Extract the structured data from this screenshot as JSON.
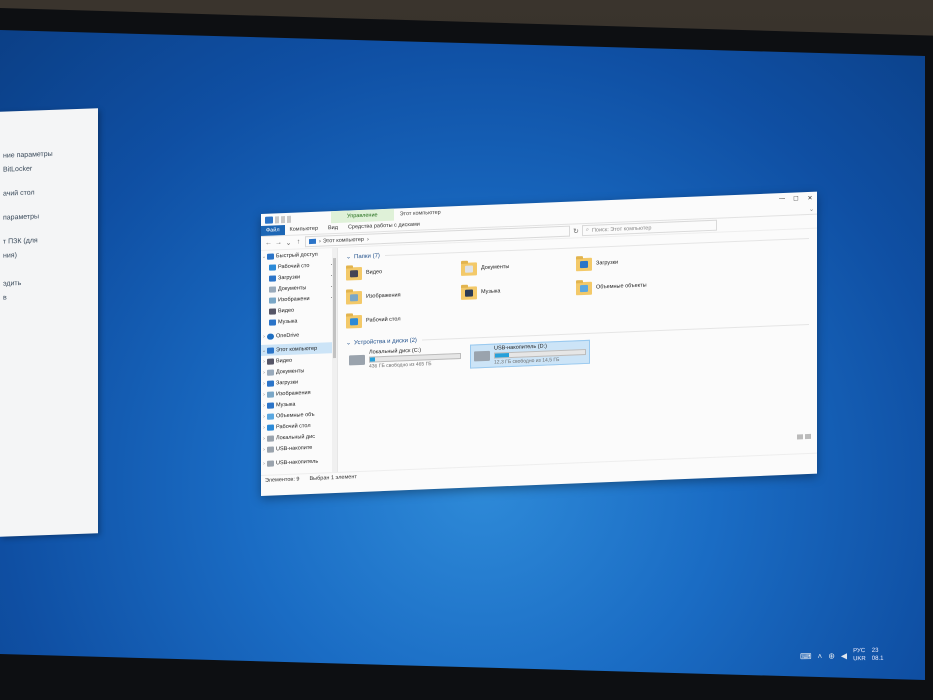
{
  "settings_panel": {
    "items": [
      "ние параметры",
      "BitLocker",
      "ачий стол",
      "",
      "параметры",
      "",
      "т ПЗК (для",
      "ния)",
      "",
      "эдить",
      "в"
    ]
  },
  "explorer": {
    "title": "Этот компьютер",
    "context_tab": "Управление",
    "ribbon_tabs": {
      "file": "Файл",
      "computer": "Компьютер",
      "view": "Вид",
      "drive_tools": "Средства работы с дисками"
    },
    "address_path": "Этот компьютер",
    "search_placeholder": "Поиск: Этот компьютер",
    "nav": {
      "quick_access": "Быстрый доступ",
      "desktop": "Рабочий сто",
      "downloads": "Загрузки",
      "documents": "Документы",
      "images": "Изображени",
      "video": "Видео",
      "music": "Музыка",
      "onedrive": "OneDrive",
      "this_pc": "Этот компьютер",
      "pc_video": "Видео",
      "pc_documents": "Документы",
      "pc_downloads": "Загрузки",
      "pc_images": "Изображения",
      "pc_music": "Музыка",
      "pc_3d": "Объемные объ",
      "pc_desktop": "Рабочий стол",
      "pc_local_disk": "Локальный дис",
      "pc_usb": "USB-накопите",
      "usb": "USB-накопитель"
    },
    "folders_header": "Папки (7)",
    "folders": {
      "video": "Видео",
      "documents": "Документы",
      "downloads": "Загрузки",
      "images": "Изображения",
      "music": "Музыка",
      "objects3d": "Объемные объекты",
      "desktop": "Рабочий стол"
    },
    "drives_header": "Устройства и диски (2)",
    "drives": [
      {
        "name": "Локальный диск (C:)",
        "free": "436 ГБ свободно из 465 ГБ",
        "used_fraction": 0.06
      },
      {
        "name": "USB-накопитель (D:)",
        "free": "12,3 ГБ свободно из 14,5 ГБ",
        "used_fraction": 0.15
      }
    ],
    "status": {
      "items": "Элементов: 9",
      "selected": "Выбран 1 элемент"
    }
  },
  "taskbar": {
    "lang_top": "РУС",
    "lang_bottom": "UKR",
    "time": "23",
    "date": "08.1"
  },
  "colors": {
    "accent": "#1c66b5",
    "folder": "#f3c969",
    "selection": "#cce4f7",
    "desktop": "#1a6cc4"
  }
}
